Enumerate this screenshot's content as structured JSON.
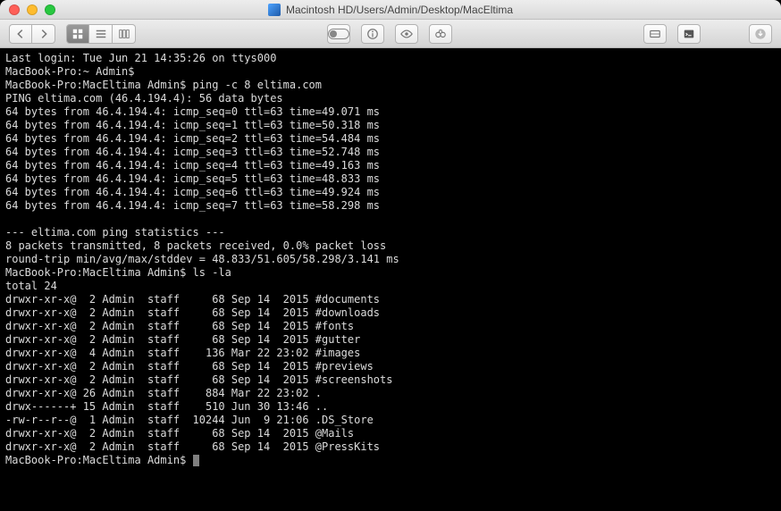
{
  "window": {
    "title": "Macintosh HD/Users/Admin/Desktop/MacEltima"
  },
  "terminal": {
    "lines": [
      "Last login: Tue Jun 21 14:35:26 on ttys000",
      "MacBook-Pro:~ Admin$",
      "MacBook-Pro:MacEltima Admin$ ping -c 8 eltima.com",
      "PING eltima.com (46.4.194.4): 56 data bytes",
      "64 bytes from 46.4.194.4: icmp_seq=0 ttl=63 time=49.071 ms",
      "64 bytes from 46.4.194.4: icmp_seq=1 ttl=63 time=50.318 ms",
      "64 bytes from 46.4.194.4: icmp_seq=2 ttl=63 time=54.484 ms",
      "64 bytes from 46.4.194.4: icmp_seq=3 ttl=63 time=52.748 ms",
      "64 bytes from 46.4.194.4: icmp_seq=4 ttl=63 time=49.163 ms",
      "64 bytes from 46.4.194.4: icmp_seq=5 ttl=63 time=48.833 ms",
      "64 bytes from 46.4.194.4: icmp_seq=6 ttl=63 time=49.924 ms",
      "64 bytes from 46.4.194.4: icmp_seq=7 ttl=63 time=58.298 ms",
      "",
      "--- eltima.com ping statistics ---",
      "8 packets transmitted, 8 packets received, 0.0% packet loss",
      "round-trip min/avg/max/stddev = 48.833/51.605/58.298/3.141 ms",
      "MacBook-Pro:MacEltima Admin$ ls -la",
      "total 24",
      "drwxr-xr-x@  2 Admin  staff     68 Sep 14  2015 #documents",
      "drwxr-xr-x@  2 Admin  staff     68 Sep 14  2015 #downloads",
      "drwxr-xr-x@  2 Admin  staff     68 Sep 14  2015 #fonts",
      "drwxr-xr-x@  2 Admin  staff     68 Sep 14  2015 #gutter",
      "drwxr-xr-x@  4 Admin  staff    136 Mar 22 23:02 #images",
      "drwxr-xr-x@  2 Admin  staff     68 Sep 14  2015 #previews",
      "drwxr-xr-x@  2 Admin  staff     68 Sep 14  2015 #screenshots",
      "drwxr-xr-x@ 26 Admin  staff    884 Mar 22 23:02 .",
      "drwx------+ 15 Admin  staff    510 Jun 30 13:46 ..",
      "-rw-r--r--@  1 Admin  staff  10244 Jun  9 21:06 .DS_Store",
      "drwxr-xr-x@  2 Admin  staff     68 Sep 14  2015 @Mails",
      "drwxr-xr-x@  2 Admin  staff     68 Sep 14  2015 @PressKits"
    ],
    "prompt": "MacBook-Pro:MacEltima Admin$ "
  }
}
